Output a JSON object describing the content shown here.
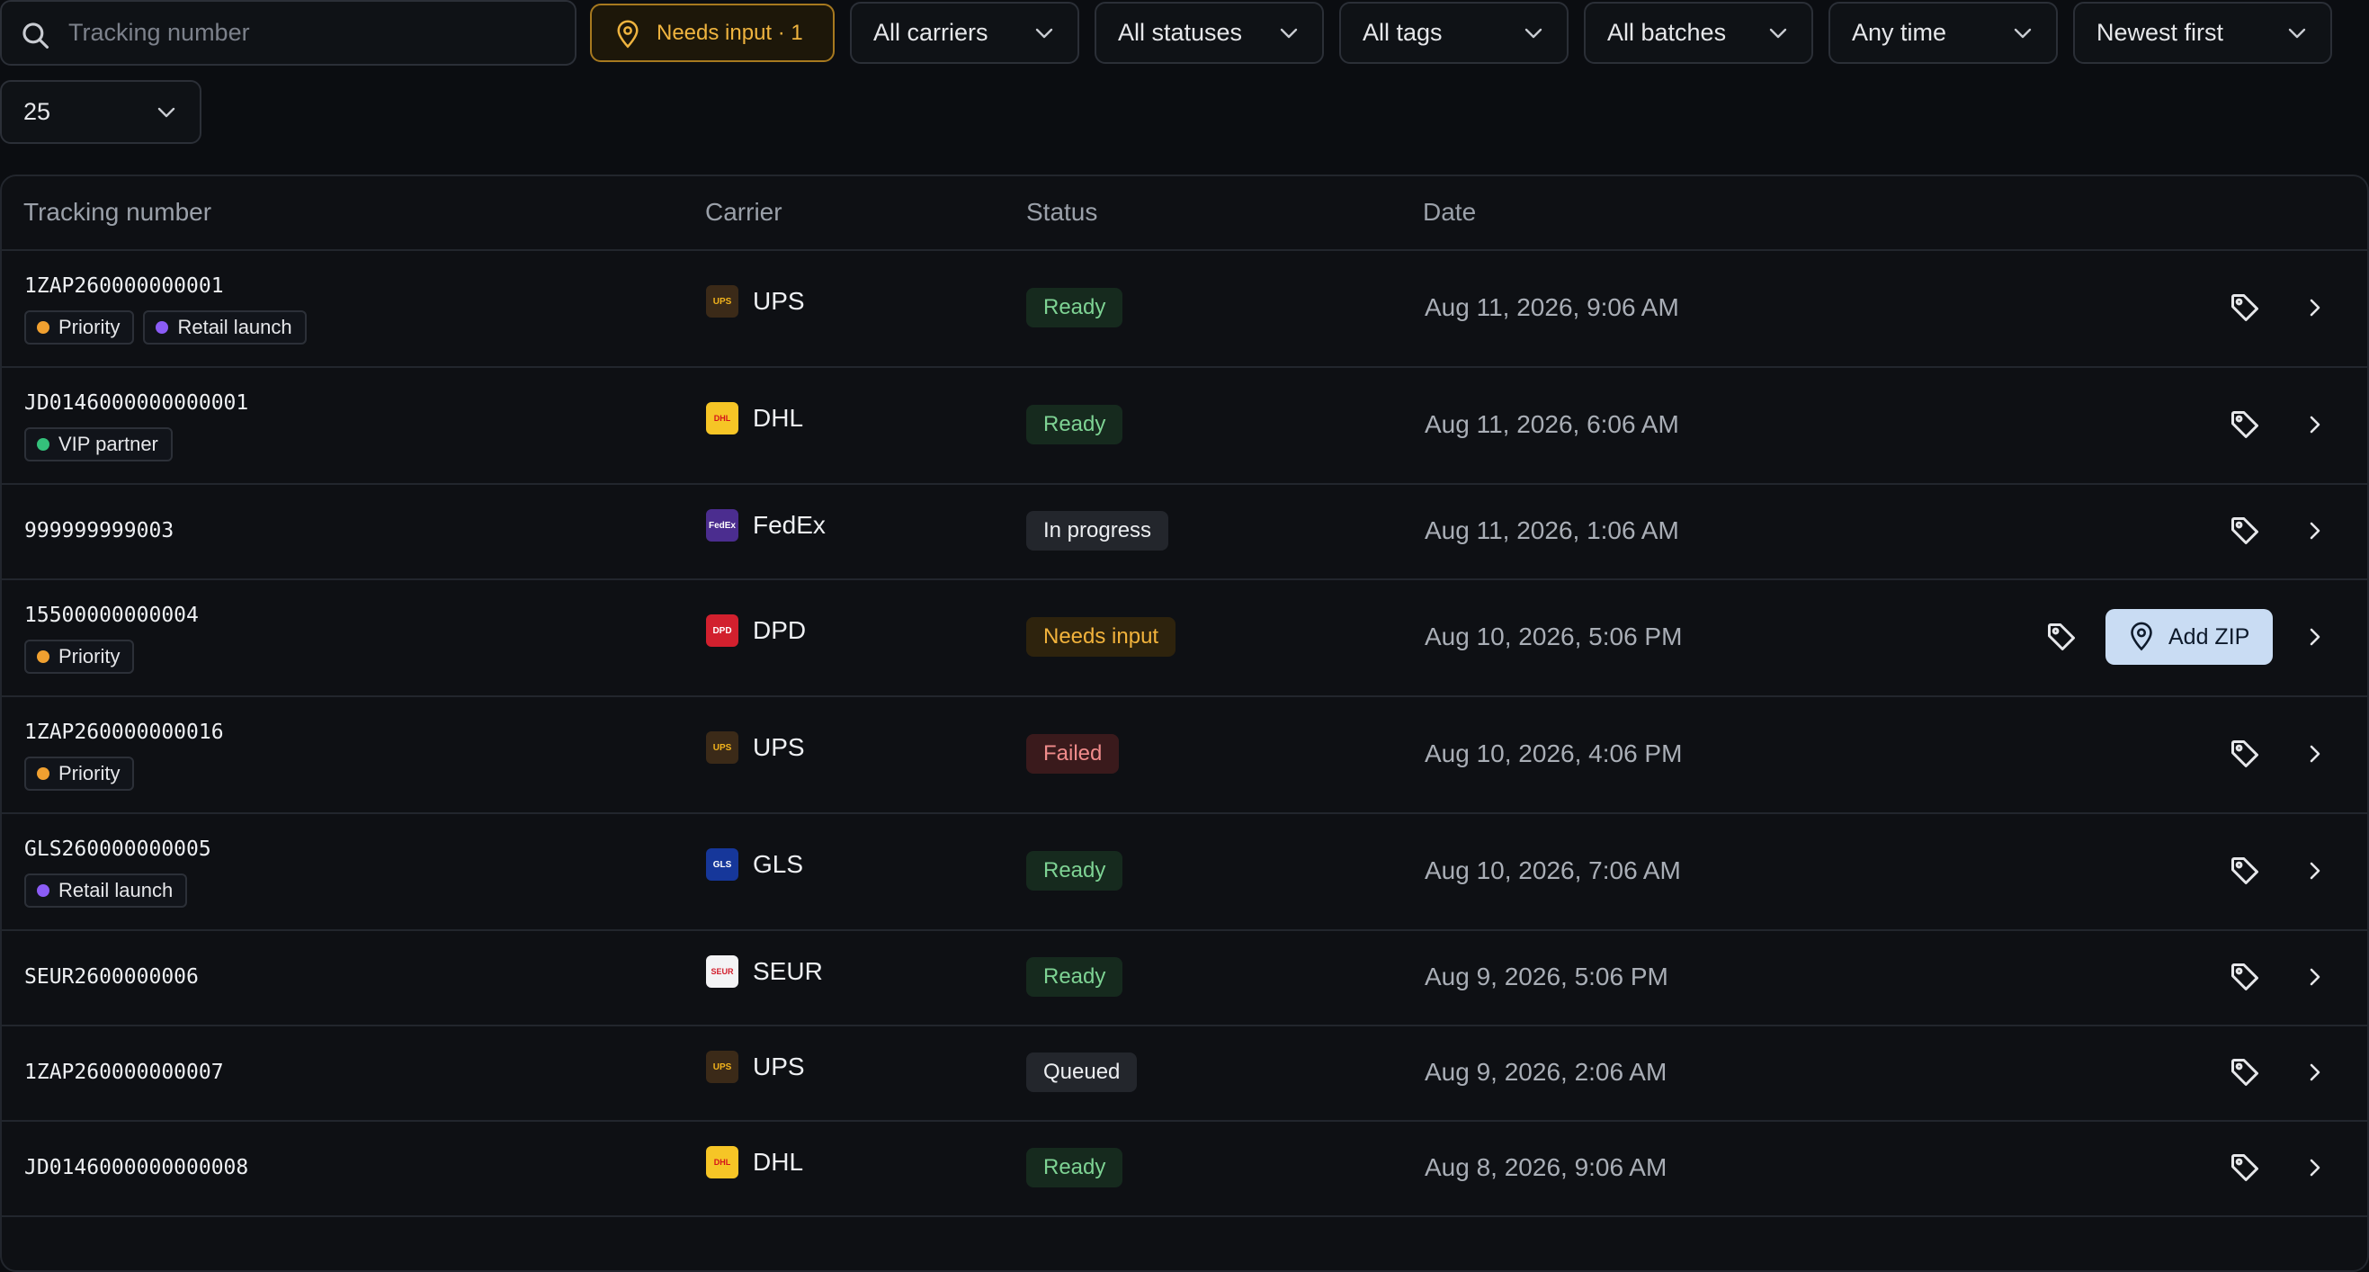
{
  "filters": {
    "search_placeholder": "Tracking number",
    "needs_input_label": "Needs input · 1",
    "carriers": "All carriers",
    "statuses": "All statuses",
    "tags": "All tags",
    "batches": "All batches",
    "time": "Any time",
    "sort": "Newest first",
    "page_size": "25"
  },
  "table": {
    "columns": {
      "tracking": "Tracking number",
      "carrier": "Carrier",
      "status": "Status",
      "date": "Date"
    },
    "add_zip_label": "Add ZIP",
    "rows": [
      {
        "tracking": "1ZAP260000000001",
        "tags": [
          {
            "label": "Priority",
            "color": "#f0a030"
          },
          {
            "label": "Retail launch",
            "color": "#8b5cf6"
          }
        ],
        "carrier": "UPS",
        "logo_text": "UPS",
        "status": "Ready",
        "date": "Aug 11, 2026, 9:06 AM"
      },
      {
        "tracking": "JD0146000000000001",
        "tags": [
          {
            "label": "VIP partner",
            "color": "#34c17b"
          }
        ],
        "carrier": "DHL",
        "logo_text": "DHL",
        "status": "Ready",
        "date": "Aug 11, 2026, 6:06 AM"
      },
      {
        "tracking": "999999999003",
        "tags": [],
        "carrier": "FedEx",
        "logo_text": "FedEx",
        "status": "In progress",
        "date": "Aug 11, 2026, 1:06 AM"
      },
      {
        "tracking": "15500000000004",
        "tags": [
          {
            "label": "Priority",
            "color": "#f0a030"
          }
        ],
        "carrier": "DPD",
        "logo_text": "DPD",
        "status": "Needs input",
        "date": "Aug 10, 2026, 5:06 PM"
      },
      {
        "tracking": "1ZAP260000000016",
        "tags": [
          {
            "label": "Priority",
            "color": "#f0a030"
          }
        ],
        "carrier": "UPS",
        "logo_text": "UPS",
        "status": "Failed",
        "date": "Aug 10, 2026, 4:06 PM"
      },
      {
        "tracking": "GLS260000000005",
        "tags": [
          {
            "label": "Retail launch",
            "color": "#8b5cf6"
          }
        ],
        "carrier": "GLS",
        "logo_text": "GLS",
        "status": "Ready",
        "date": "Aug 10, 2026, 7:06 AM"
      },
      {
        "tracking": "SEUR2600000006",
        "tags": [],
        "carrier": "SEUR",
        "logo_text": "SEUR",
        "status": "Ready",
        "date": "Aug 9, 2026, 5:06 PM"
      },
      {
        "tracking": "1ZAP260000000007",
        "tags": [],
        "carrier": "UPS",
        "logo_text": "UPS",
        "status": "Queued",
        "date": "Aug 9, 2026, 2:06 AM"
      },
      {
        "tracking": "JD0146000000000008",
        "tags": [],
        "carrier": "DHL",
        "logo_text": "DHL",
        "status": "Ready",
        "date": "Aug 8, 2026, 9:06 AM"
      }
    ]
  }
}
